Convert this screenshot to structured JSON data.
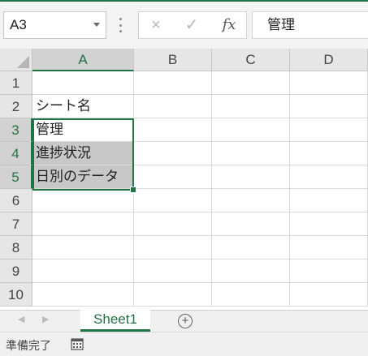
{
  "namebox": {
    "value": "A3"
  },
  "formula_bar": {
    "cancel_icon": "×",
    "enter_icon": "✓",
    "fx_label": "fx",
    "value": "管理"
  },
  "columns": [
    "A",
    "B",
    "C",
    "D"
  ],
  "rows": [
    "1",
    "2",
    "3",
    "4",
    "5",
    "6",
    "7",
    "8",
    "9",
    "10"
  ],
  "cells": {
    "A2": "シート名",
    "A3": "管理",
    "A4": "進捗状況",
    "A5": "日別のデータ"
  },
  "selection": {
    "range": "A3:A5",
    "active": "A3",
    "shaded": [
      "A4",
      "A5"
    ]
  },
  "sheets": [
    {
      "name": "Sheet1",
      "active": true
    }
  ],
  "status": {
    "text": "準備完了",
    "icon": "macro-record-icon"
  },
  "colors": {
    "accent": "#217346",
    "header_bg": "#e6e6e6",
    "selected_fill": "#c8c8c8"
  }
}
